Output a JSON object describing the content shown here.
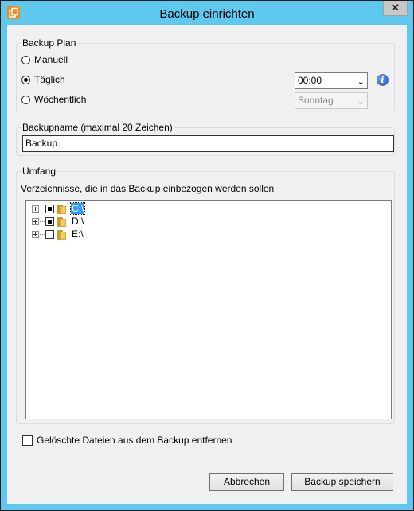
{
  "window": {
    "title": "Backup einrichten",
    "close_glyph": "✕"
  },
  "backup_plan": {
    "legend": "Backup Plan",
    "options": [
      "Manuell",
      "Täglich",
      "Wöchentlich"
    ],
    "selected": "Täglich",
    "time_value": "00:00",
    "weekday_value": "Sonntag",
    "info_glyph": "i"
  },
  "backup_name": {
    "legend": "Backupname (maximal 20 Zeichen)",
    "value": "Backup"
  },
  "scope": {
    "legend": "Umfang",
    "description": "Verzeichnisse, die in das Backup einbezogen werden sollen",
    "drives": [
      {
        "label": "C:\\",
        "check_state": "partial",
        "selected": true
      },
      {
        "label": "D:\\",
        "check_state": "partial",
        "selected": false
      },
      {
        "label": "E:\\",
        "check_state": "unchecked",
        "selected": false
      }
    ]
  },
  "delete_option": {
    "label": "Gelöschte Dateien aus dem Backup entfernen",
    "checked": false
  },
  "buttons": {
    "cancel": "Abbrechen",
    "save": "Backup speichern"
  },
  "colors": {
    "title_bar": "#5ec8ee",
    "selection": "#3399ff",
    "app_icon": "#f08a1c"
  }
}
